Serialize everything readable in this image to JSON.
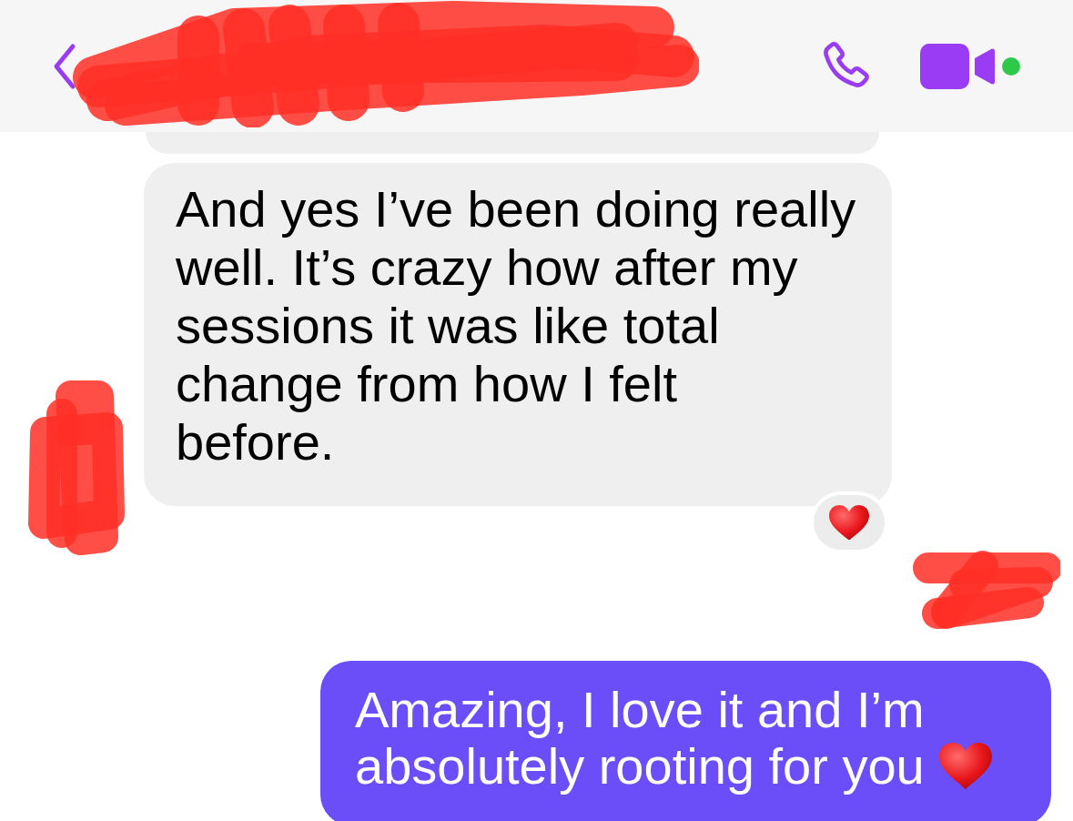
{
  "header": {
    "online": true
  },
  "messages": [
    {
      "kind": "incoming"
    },
    {
      "kind": "incoming",
      "text": "And yes I’ve been doing really well. It’s crazy how after my sessions it was like total change from how I felt\nbefore.",
      "reacted": true
    },
    {
      "kind": "outgoing",
      "text": "Amazing, I love it and I’m absolutely rooting for you",
      "ends_with_heart": true
    }
  ]
}
